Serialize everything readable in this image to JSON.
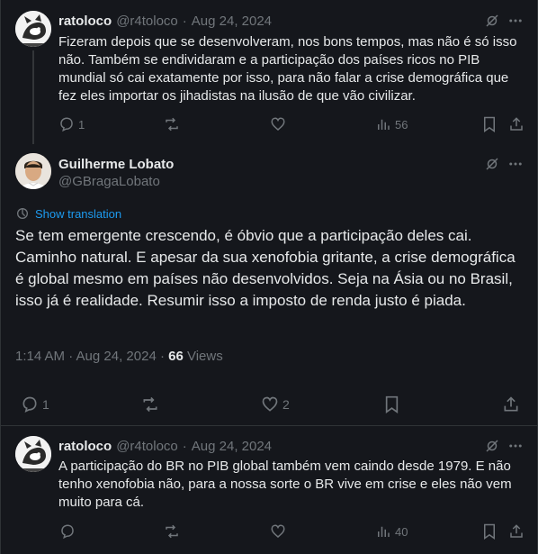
{
  "colors": {
    "background": "#15171c",
    "text": "#e7e9ea",
    "muted": "#71767b",
    "link": "#1d9bf0",
    "divider": "#2f3336"
  },
  "posts": [
    {
      "author": "ratoloco",
      "handle": "@r4toloco",
      "sep": "·",
      "date": "Aug 24, 2024",
      "text": "Fizeram depois que se desenvolveram, nos bons tempos, mas não é só isso não. Também se endividaram e a participação dos países ricos no PIB mundial só cai exatamente por isso, para não falar a crise demográfica que fez eles importar os jihadistas na ilusão de que vão civilizar.",
      "replies": "1",
      "views": "56",
      "avatar_icon": "rat-avatar"
    },
    {
      "author": "Guilherme Lobato",
      "handle": "@GBragaLobato",
      "translate_label": "Show translation",
      "text": "Se tem emergente crescendo, é óbvio que a participação deles cai. Caminho natural. E apesar da sua xenofobia gritante, a crise demográfica é global mesmo em países não desenvolvidos. Seja na Ásia ou no Brasil, isso já é realidade. Resumir isso a imposto de renda justo é piada.",
      "time": "1:14 AM · Aug 24, 2024 · ",
      "views_count": "66",
      "views_label": " Views",
      "replies": "1",
      "likes": "2",
      "avatar_icon": "person-avatar"
    },
    {
      "author": "ratoloco",
      "handle": "@r4toloco",
      "sep": "·",
      "date": "Aug 24, 2024",
      "text": "A participação do BR no PIB global também vem caindo desde 1979. E não tenho xenofobia não, para a nossa sorte o BR vive em crise e eles não vem muito para cá.",
      "views": "40",
      "avatar_icon": "rat-avatar"
    }
  ]
}
